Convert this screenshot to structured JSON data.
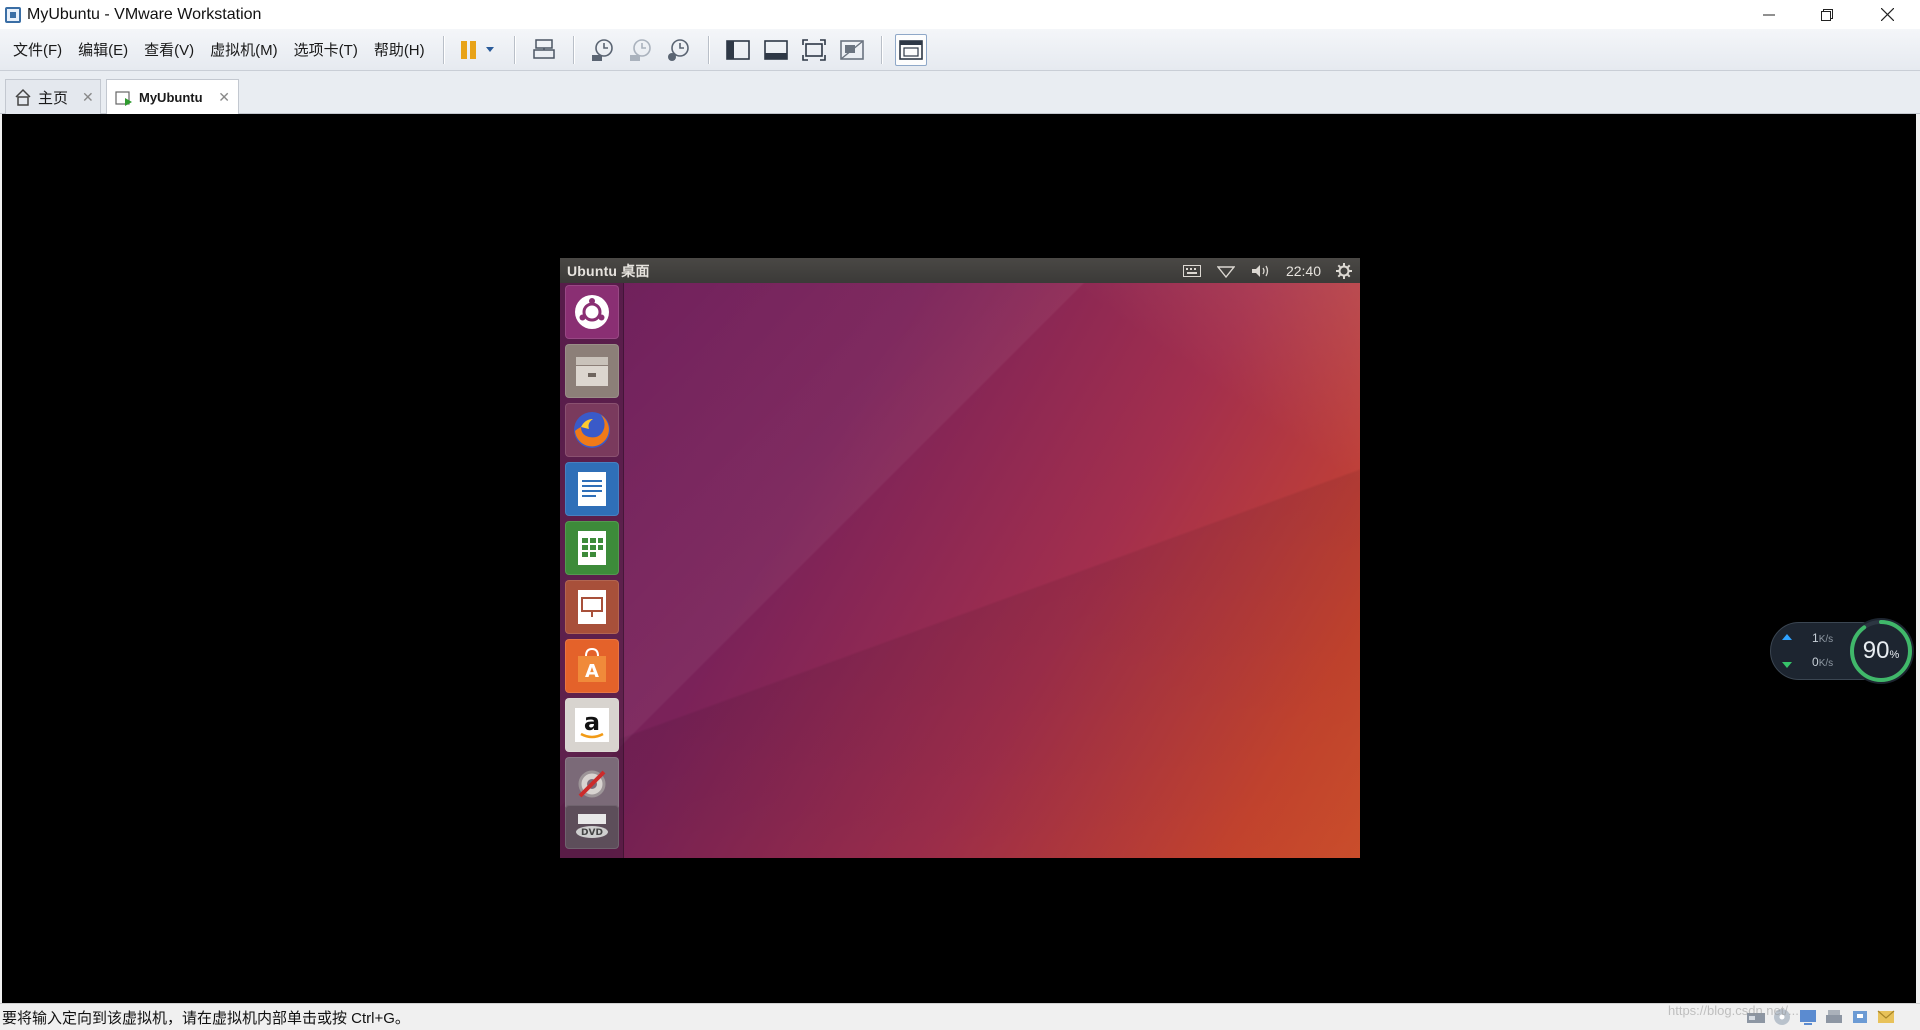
{
  "window": {
    "title": "MyUbuntu  - VMware Workstation",
    "controls": {
      "minimize": "—",
      "restore": "❐",
      "close": "✕"
    }
  },
  "menu": {
    "file": "文件(F)",
    "edit": "编辑(E)",
    "view": "查看(V)",
    "vm": "虚拟机(M)",
    "tabs": "选项卡(T)",
    "help": "帮助(H)"
  },
  "tabs": [
    {
      "label": "主页",
      "icon": "home-icon",
      "active": false
    },
    {
      "label": "MyUbuntu",
      "icon": "vm-icon",
      "active": true
    }
  ],
  "guest": {
    "panel_title": "Ubuntu 桌面",
    "clock": "22:40",
    "indicators": [
      "keyboard-icon",
      "wifi-icon",
      "volume-icon",
      "gear-icon"
    ],
    "launcher": [
      "dash-home-icon",
      "files-icon",
      "firefox-icon",
      "writer-icon",
      "calc-icon",
      "impress-icon",
      "software-center-icon",
      "amazon-icon",
      "system-settings-icon",
      "dvd-icon"
    ]
  },
  "net_widget": {
    "upload": "1",
    "download": "0",
    "unit": "K/s",
    "percent": "90",
    "percent_sign": "%",
    "percent_value": 90
  },
  "status": {
    "hint": "要将输入定向到该虚拟机，请在虚拟机内部单击或按 Ctrl+G。",
    "watermark": "https://blog.csdn.net/..."
  },
  "colors": {
    "wallpaper_start": "#6d1f5c",
    "wallpaper_end": "#d0502c",
    "panel": "#3b3a38",
    "console_bg": "#000000"
  }
}
